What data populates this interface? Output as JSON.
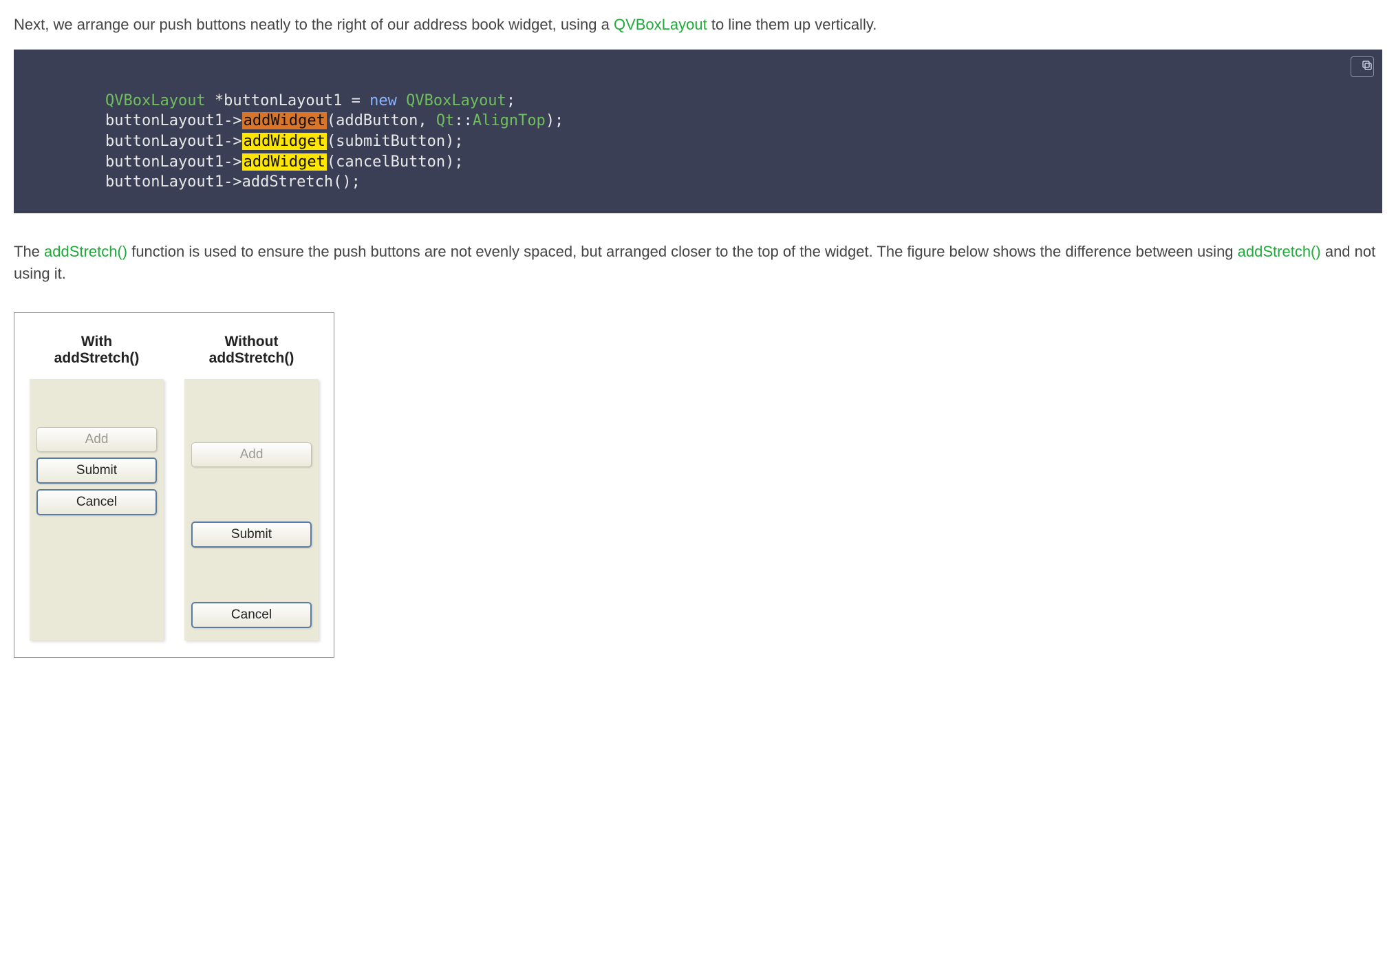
{
  "para1": {
    "pre": "Next, we arrange our push buttons neatly to the right of our address book widget, using a ",
    "link": "QVBoxLayout",
    "post": " to line them up vertically."
  },
  "code": {
    "t_type1": "QVBoxLayout",
    "t_decl": " *buttonLayout1 = ",
    "t_new": "new",
    "t_type2": " QVBoxLayout",
    "t_semi": ";",
    "l2a": "    buttonLayout1->",
    "l2b": "addWidget",
    "l2c": "(addButton, ",
    "l2d": "Qt",
    "l2e": "::",
    "l2f": "AlignTop",
    "l2g": ");",
    "l3a": "    buttonLayout1->",
    "l3b": "addWidget",
    "l3c": "(submitButton);",
    "l4a": "    buttonLayout1->",
    "l4b": "addWidget",
    "l4c": "(cancelButton);",
    "l5": "    buttonLayout1->addStretch();"
  },
  "para2": {
    "t1": "The ",
    "link1": "addStretch()",
    "t2": " function is used to ensure the push buttons are not evenly spaced, but arranged closer to the top of the widget. The figure below shows the difference between using ",
    "link2": "addStretch()",
    "t3": " and not using it."
  },
  "figure": {
    "with_l1": "With",
    "with_l2": "addStretch()",
    "without_l1": "Without",
    "without_l2": "addStretch()",
    "btn_add": "Add",
    "btn_submit": "Submit",
    "btn_cancel": "Cancel"
  }
}
